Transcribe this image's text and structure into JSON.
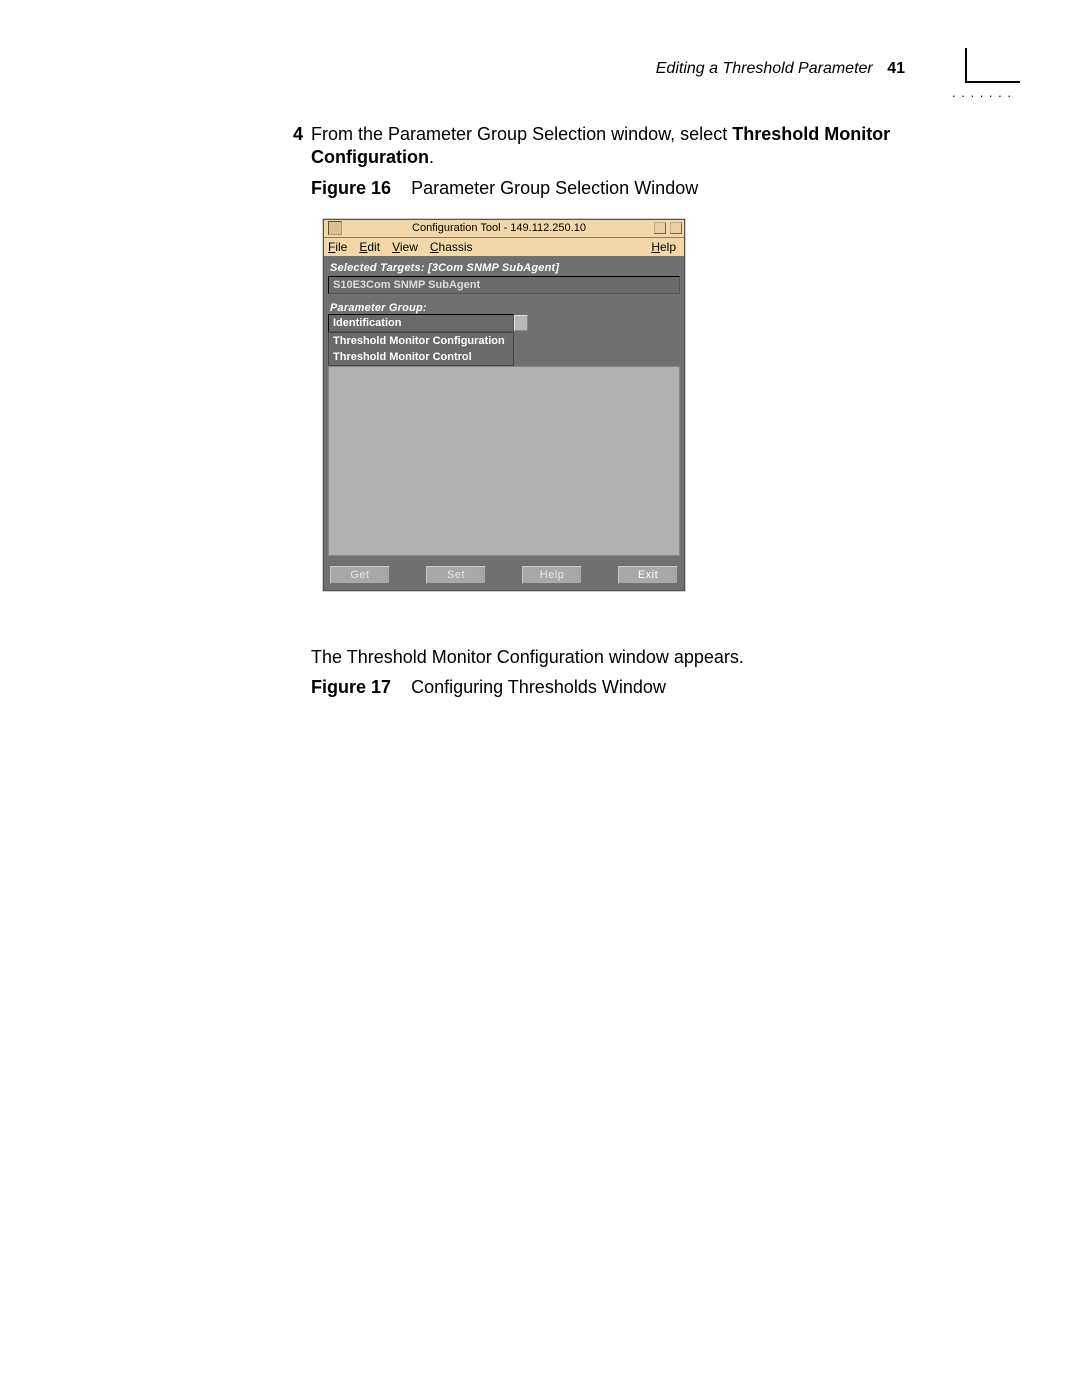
{
  "header": {
    "section_title": "Editing a Threshold Parameter",
    "page_number": "41"
  },
  "step": {
    "number": "4",
    "text_prefix": "From the Parameter Group Selection window, select ",
    "bold_text": "Threshold Monitor Configuration",
    "text_suffix": "."
  },
  "figure16": {
    "label": "Figure 16",
    "caption": "Parameter Group Selection Window"
  },
  "window": {
    "title": "Configuration Tool - 149.112.250.10",
    "menu": {
      "file": "File",
      "edit": "Edit",
      "view": "View",
      "chassis": "Chassis",
      "help": "Help"
    },
    "selected_targets_label": "Selected Targets:  [3Com SNMP SubAgent]",
    "selected_targets_value": "S10E3Com SNMP SubAgent",
    "parameter_group_label": "Parameter Group:",
    "parameter_group_value": "Identification",
    "dropdown_items": [
      "Threshold Monitor Configuration",
      "Threshold Monitor Control"
    ],
    "buttons": {
      "get": "Get",
      "set": "Set",
      "help": "Help",
      "exit": "Exit"
    }
  },
  "after_figure_text": "The Threshold Monitor Configuration window appears.",
  "figure17": {
    "label": "Figure 17",
    "caption": "Configuring Thresholds Window"
  }
}
